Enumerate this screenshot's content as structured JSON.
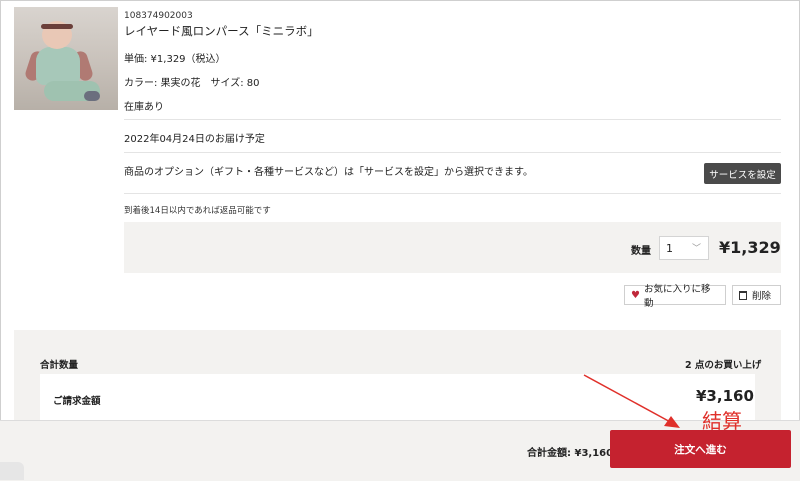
{
  "item": {
    "sku": "108374902003",
    "name": "レイヤード風ロンパース「ミニラボ」",
    "price_line": "単価: ¥1,329（税込）",
    "variant_line": "カラー: 果実の花　サイズ: 80",
    "stock": "在庫あり",
    "delivery": "2022年04月24日のお届け予定",
    "service_note": "商品のオプション（ギフト・各種サービスなど）は「サービスを設定」から選択できます。",
    "service_button": "サービスを設定",
    "return_note": "到着後14日以内であれば返品可能です",
    "qty_label": "数量",
    "qty_value": "1",
    "line_price": "¥1,329",
    "favorite_button": "お気に入りに移動",
    "delete_button": "削除"
  },
  "summary": {
    "count_label": "合計数量",
    "count_value": "2 点のお買い上げ",
    "bill_label": "ご請求金額",
    "bill_amount": "¥3,160"
  },
  "annotation": {
    "text": "結算",
    "color": "#e0302a"
  },
  "footer": {
    "total_text": "合計金額: ¥3,160",
    "checkout_button": "注文へ進む",
    "accent": "#c5222f"
  },
  "icons": {
    "heart": "heart-icon",
    "trash": "trash-icon",
    "chevron": "chevron-down-icon"
  }
}
